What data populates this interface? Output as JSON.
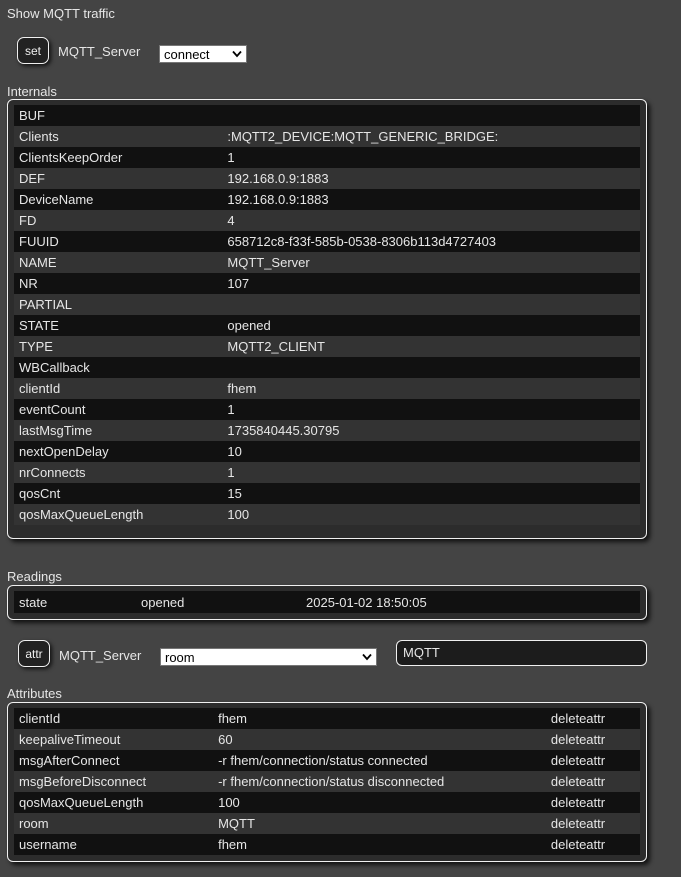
{
  "top_link": "Show MQTT traffic",
  "set_row": {
    "button": "set",
    "device": "MQTT_Server",
    "select_value": "connect"
  },
  "internals": {
    "label": "Internals",
    "rows": [
      {
        "name": "BUF",
        "value": ""
      },
      {
        "name": "Clients",
        "value": ":MQTT2_DEVICE:MQTT_GENERIC_BRIDGE:"
      },
      {
        "name": "ClientsKeepOrder",
        "value": "1"
      },
      {
        "name": "DEF",
        "value": "192.168.0.9:1883"
      },
      {
        "name": "DeviceName",
        "value": "192.168.0.9:1883"
      },
      {
        "name": "FD",
        "value": "4"
      },
      {
        "name": "FUUID",
        "value": "658712c8-f33f-585b-0538-8306b113d4727403"
      },
      {
        "name": "NAME",
        "value": "MQTT_Server"
      },
      {
        "name": "NR",
        "value": "107"
      },
      {
        "name": "PARTIAL",
        "value": ""
      },
      {
        "name": "STATE",
        "value": "opened"
      },
      {
        "name": "TYPE",
        "value": "MQTT2_CLIENT"
      },
      {
        "name": "WBCallback",
        "value": ""
      },
      {
        "name": "clientId",
        "value": "fhem"
      },
      {
        "name": "eventCount",
        "value": "1"
      },
      {
        "name": "lastMsgTime",
        "value": "1735840445.30795"
      },
      {
        "name": "nextOpenDelay",
        "value": "10"
      },
      {
        "name": "nrConnects",
        "value": "1"
      },
      {
        "name": "qosCnt",
        "value": "15"
      },
      {
        "name": "qosMaxQueueLength",
        "value": "100"
      }
    ]
  },
  "readings": {
    "label": "Readings",
    "rows": [
      {
        "name": "state",
        "value": "opened",
        "time": "2025-01-02 18:50:05"
      }
    ]
  },
  "attr_row": {
    "button": "attr",
    "device": "MQTT_Server",
    "select_value": "room",
    "input_value": "MQTT"
  },
  "attributes": {
    "label": "Attributes",
    "rows": [
      {
        "name": "clientId",
        "value": "fhem",
        "action": "deleteattr"
      },
      {
        "name": "keepaliveTimeout",
        "value": "60",
        "action": "deleteattr"
      },
      {
        "name": "msgAfterConnect",
        "value": "-r fhem/connection/status connected",
        "action": "deleteattr"
      },
      {
        "name": "msgBeforeDisconnect",
        "value": "-r fhem/connection/status disconnected",
        "action": "deleteattr"
      },
      {
        "name": "qosMaxQueueLength",
        "value": "100",
        "action": "deleteattr"
      },
      {
        "name": "room",
        "value": "MQTT",
        "action": "deleteattr"
      },
      {
        "name": "username",
        "value": "fhem",
        "action": "deleteattr"
      }
    ]
  }
}
